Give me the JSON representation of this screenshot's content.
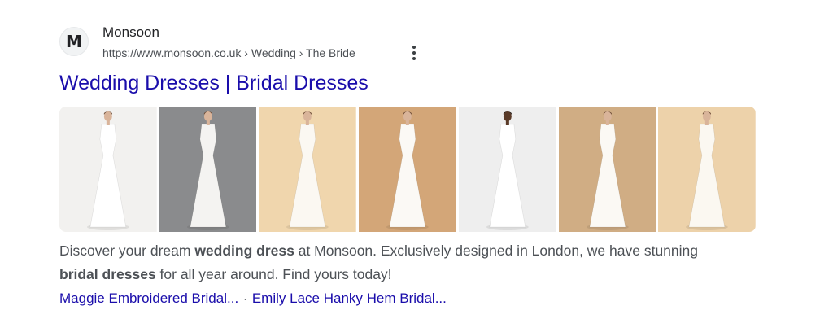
{
  "site": {
    "favicon_letter": "M",
    "name": "Monsoon",
    "url": "https://www.monsoon.co.uk › Wedding › The Bride",
    "more_icon": "more-vert-icon"
  },
  "title": "Wedding Dresses | Bridal Dresses",
  "images": [
    {
      "bg": "#f2f1ef",
      "dress": "#ffffff"
    },
    {
      "bg": "#8a8b8d",
      "dress": "#f4f3f1"
    },
    {
      "bg": "#f0d6ad",
      "dress": "#fbf8f2"
    },
    {
      "bg": "#d3a678",
      "dress": "#fbf9f5"
    },
    {
      "bg": "#eeeeee",
      "dress": "#ffffff"
    },
    {
      "bg": "#d0ad84",
      "dress": "#fbf9f4"
    },
    {
      "bg": "#edd2aa",
      "dress": "#fbf8f1"
    }
  ],
  "description": {
    "p1": "Discover your dream ",
    "b1": "wedding dress",
    "p2": " at Monsoon. Exclusively designed in London, we have stunning",
    "b2": "bridal dresses",
    "p3": " for all year around. Find yours today!"
  },
  "sitelinks": [
    {
      "label": "Maggie Embroidered Bridal..."
    },
    {
      "label": "Emily Lace Hanky Hem Bridal..."
    }
  ],
  "sitelink_separator": "·"
}
